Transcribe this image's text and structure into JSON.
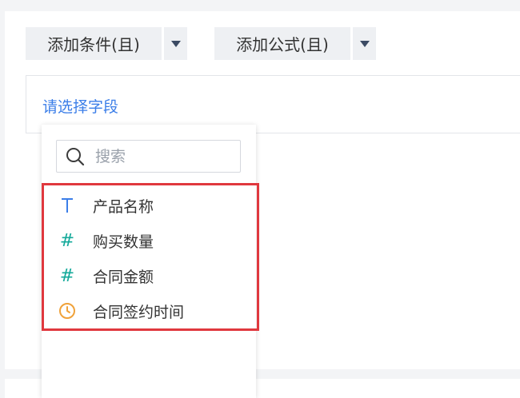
{
  "toolbar": {
    "add_condition_label": "添加条件(且)",
    "add_formula_label": "添加公式(且)"
  },
  "field_box": {
    "placeholder": "请选择字段"
  },
  "dropdown": {
    "search": {
      "placeholder": "搜索",
      "value": ""
    },
    "fields": [
      {
        "label": "产品名称",
        "type_icon": "text-type-icon",
        "glyph": "T"
      },
      {
        "label": "购买数量",
        "type_icon": "number-type-icon",
        "glyph": "#"
      },
      {
        "label": "合同金额",
        "type_icon": "number-type-icon",
        "glyph": "#"
      },
      {
        "label": "合同签约时间",
        "type_icon": "date-type-icon",
        "glyph": ""
      }
    ]
  },
  "colors": {
    "accent_blue": "#3b7ee8",
    "number_teal": "#14a99a",
    "date_orange": "#f0a23a",
    "highlight_red": "#e0383e"
  }
}
